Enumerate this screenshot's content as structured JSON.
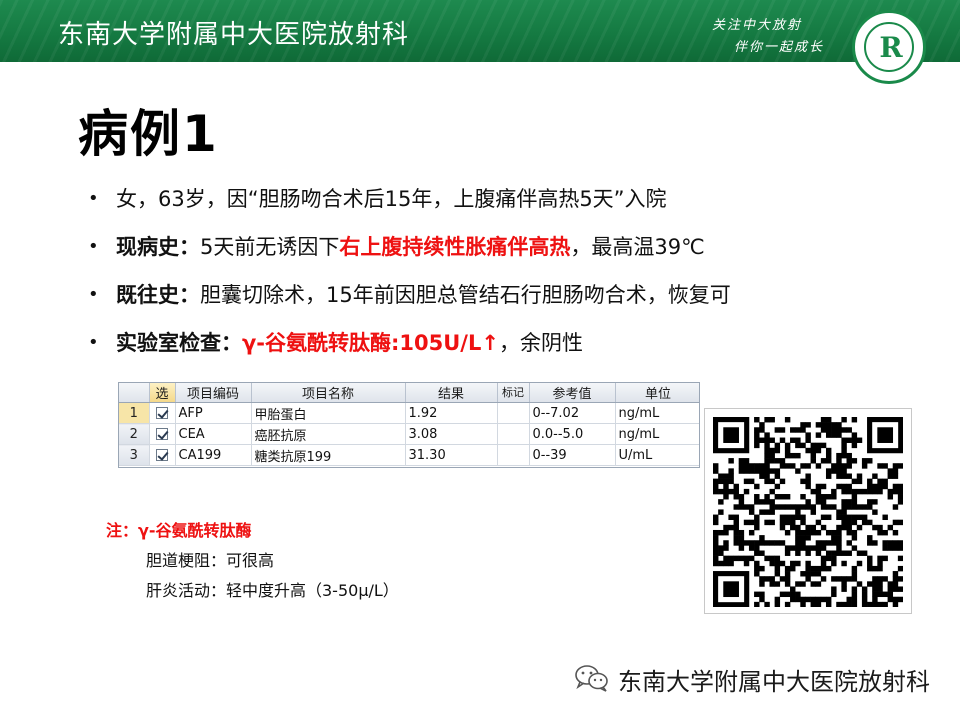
{
  "header": {
    "title": "东南大学附属中大医院放射科",
    "slogan_line1": "关注中大放射",
    "slogan_line2": "伴你一起成长",
    "logo_letter": "R"
  },
  "slide": {
    "title": "病例1"
  },
  "bullets": {
    "b1": "女，63岁，因“胆肠吻合术后15年，上腹痛伴高热5天”入院",
    "b2_label": "现病史：",
    "b2_pre": "5天前无诱因下",
    "b2_red": "右上腹持续性胀痛伴高热",
    "b2_post": "，最高温39℃",
    "b3_label": "既往史：",
    "b3_text": "胆囊切除术，15年前因胆总管结石行胆肠吻合术，恢复可",
    "b4_label": "实验室检查：",
    "b4_red": "γ-谷氨酰转肽酶:105U/L↑",
    "b4_post": "，余阴性"
  },
  "lab_table": {
    "headers": [
      "",
      "选",
      "项目编码",
      "项目名称",
      "结果",
      "标记",
      "参考值",
      "单位"
    ],
    "rows": [
      {
        "num": "1",
        "checked": true,
        "code": "AFP",
        "name": "甲胎蛋白",
        "result": "1.92",
        "flag": "",
        "ref": "0--7.02",
        "unit": "ng/mL"
      },
      {
        "num": "2",
        "checked": true,
        "code": "CEA",
        "name": "癌胚抗原",
        "result": "3.08",
        "flag": "",
        "ref": "0.0--5.0",
        "unit": "ng/mL"
      },
      {
        "num": "3",
        "checked": true,
        "code": "CA199",
        "name": "糖类抗原199",
        "result": "31.30",
        "flag": "",
        "ref": "0--39",
        "unit": "U/mL"
      }
    ]
  },
  "note": {
    "title": "注：γ-谷氨酰转肽酶",
    "line1": "胆道梗阻：可很高",
    "line2": "肝炎活动：轻中度升高（3-50μ/L）"
  },
  "footer": {
    "text": "东南大学附属中大医院放射科"
  },
  "colors": {
    "banner_green": "#157a42",
    "highlight_red": "#ee1111"
  }
}
